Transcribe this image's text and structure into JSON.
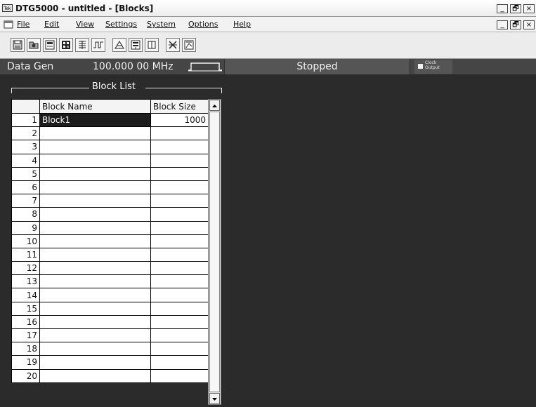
{
  "window": {
    "app_icon_text": "Tek",
    "title": "DTG5000 - untitled - [Blocks]",
    "min_glyph": "_",
    "restore_glyph": "🗗",
    "close_glyph": "×"
  },
  "menu": [
    "File",
    "Edit",
    "View",
    "Settings",
    "System",
    "Options",
    "Help"
  ],
  "toolbar_icons": [
    "save-icon",
    "open-icon",
    "setup-icon",
    "pattern-icon",
    "sequence-icon",
    "timing-icon",
    "channel-icon",
    "group-icon",
    "block-icon",
    "jumps-icon",
    "subsequence-icon"
  ],
  "status": {
    "mode": "Data Gen",
    "frequency": "100.000 00 MHz",
    "state": "Stopped",
    "clock_label_line1": "Clock",
    "clock_label_line2": "Output"
  },
  "block_list": {
    "title": "Block List",
    "columns": [
      "",
      "Block Name",
      "Block Size"
    ],
    "rows": [
      {
        "num": "1",
        "name": "Block1",
        "size": "1000"
      },
      {
        "num": "2",
        "name": "",
        "size": ""
      },
      {
        "num": "3",
        "name": "",
        "size": ""
      },
      {
        "num": "4",
        "name": "",
        "size": ""
      },
      {
        "num": "5",
        "name": "",
        "size": ""
      },
      {
        "num": "6",
        "name": "",
        "size": ""
      },
      {
        "num": "7",
        "name": "",
        "size": ""
      },
      {
        "num": "8",
        "name": "",
        "size": ""
      },
      {
        "num": "9",
        "name": "",
        "size": ""
      },
      {
        "num": "10",
        "name": "",
        "size": ""
      },
      {
        "num": "11",
        "name": "",
        "size": ""
      },
      {
        "num": "12",
        "name": "",
        "size": ""
      },
      {
        "num": "13",
        "name": "",
        "size": ""
      },
      {
        "num": "14",
        "name": "",
        "size": ""
      },
      {
        "num": "15",
        "name": "",
        "size": ""
      },
      {
        "num": "16",
        "name": "",
        "size": ""
      },
      {
        "num": "17",
        "name": "",
        "size": ""
      },
      {
        "num": "18",
        "name": "",
        "size": ""
      },
      {
        "num": "19",
        "name": "",
        "size": ""
      },
      {
        "num": "20",
        "name": "",
        "size": ""
      }
    ]
  }
}
